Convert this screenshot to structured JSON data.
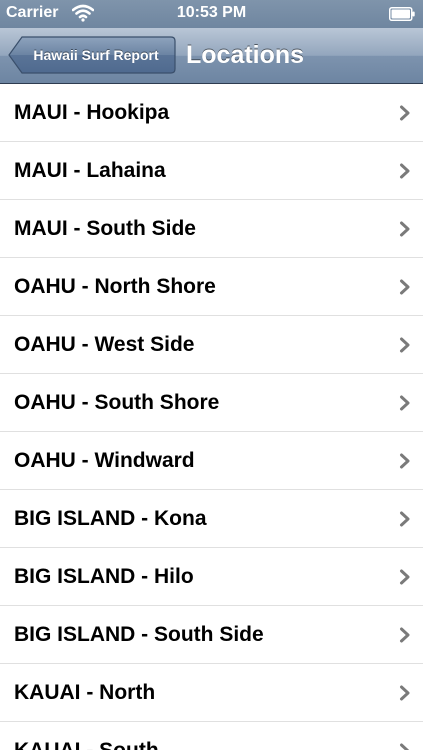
{
  "status_bar": {
    "carrier": "Carrier",
    "time": "10:53 PM"
  },
  "nav": {
    "back_label": "Hawaii Surf Report",
    "title": "Locations"
  },
  "locations": [
    {
      "label": "MAUI - Hookipa"
    },
    {
      "label": "MAUI - Lahaina"
    },
    {
      "label": "MAUI - South Side"
    },
    {
      "label": "OAHU - North Shore"
    },
    {
      "label": "OAHU - West Side"
    },
    {
      "label": "OAHU - South Shore"
    },
    {
      "label": "OAHU - Windward"
    },
    {
      "label": "BIG ISLAND - Kona"
    },
    {
      "label": "BIG ISLAND - Hilo"
    },
    {
      "label": "BIG ISLAND - South Side"
    },
    {
      "label": "KAUAI - North"
    },
    {
      "label": "KAUAI - South"
    }
  ],
  "icons": {
    "wifi": "wifi-icon",
    "battery": "battery-icon",
    "chevron": "chevron-right-icon"
  },
  "colors": {
    "nav_bar": "#7d93ae",
    "status_bar": "#7f94ab",
    "chevron": "#7a7a7a",
    "separator": "#e0e0e0"
  }
}
